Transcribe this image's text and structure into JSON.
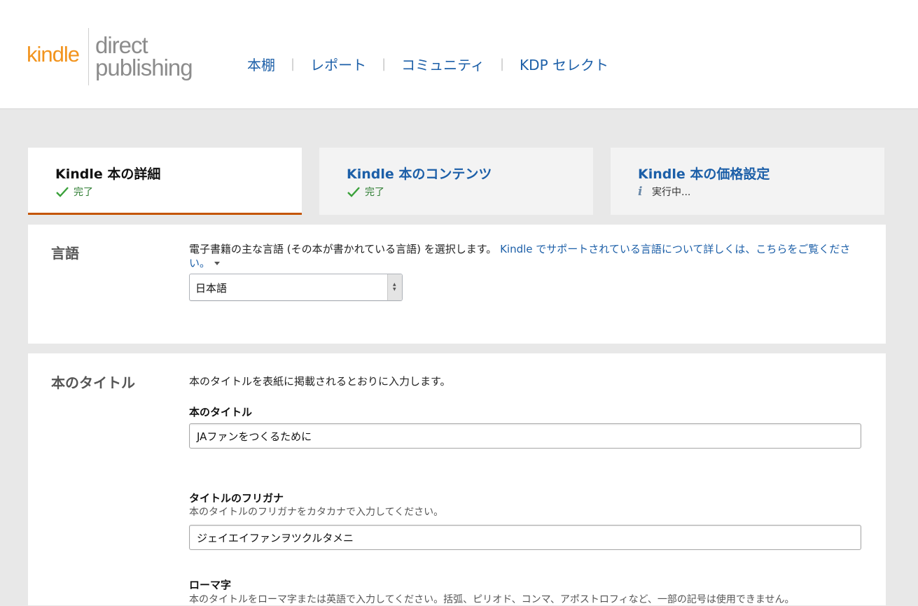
{
  "logo": {
    "kindle": "kindle",
    "direct": "direct",
    "publishing": "publishing"
  },
  "nav": {
    "items": [
      "本棚",
      "レポート",
      "コミュニティ",
      "KDP セレクト"
    ]
  },
  "steps": [
    {
      "title": "Kindle 本の詳細",
      "status": "完了",
      "status_icon": "check-icon"
    },
    {
      "title": "Kindle 本のコンテンツ",
      "status": "完了",
      "status_icon": "check-icon"
    },
    {
      "title": "Kindle 本の価格設定",
      "status": "実行中...",
      "status_icon": "info-icon"
    }
  ],
  "language": {
    "label": "言語",
    "description": "電子書籍の主な言語 (その本が書かれている言語) を選択します。",
    "help_link": "Kindle でサポートされている言語について詳しくは、こちらをご覧ください。",
    "selected": "日本語"
  },
  "title_section": {
    "label": "本のタイトル",
    "description": "本のタイトルを表紙に掲載されるとおりに入力します。",
    "book_title": {
      "label": "本のタイトル",
      "value": "JAファンをつくるために"
    },
    "furigana": {
      "label": "タイトルのフリガナ",
      "hint": "本のタイトルのフリガナをカタカナで入力してください。",
      "value": "ジェイエイファンヲツクルタメニ"
    },
    "romaji": {
      "label": "ローマ字",
      "hint": "本のタイトルをローマ字または英語で入力してください。括弧、ピリオド、コンマ、アポストロフィなど、一部の記号は使用できません。"
    }
  },
  "colors": {
    "link": "#1c5fa8",
    "accent": "#c45500",
    "done": "#2e7d32",
    "logo_orange": "#f2941e"
  }
}
